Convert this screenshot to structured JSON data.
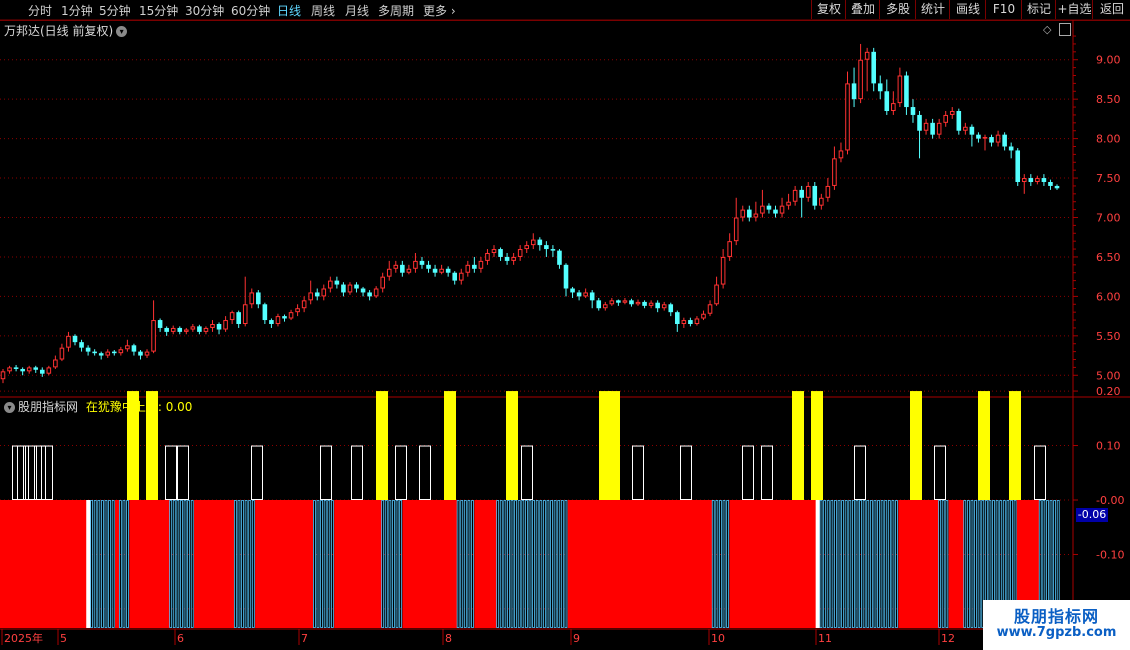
{
  "topbar": {
    "periods": [
      "分时",
      "1分钟",
      "5分钟",
      "15分钟",
      "30分钟",
      "60分钟",
      "日线",
      "周线",
      "月线",
      "多周期",
      "更多"
    ],
    "active_period": "日线",
    "right_buttons": [
      "复权",
      "叠加",
      "多股",
      "统计",
      "画线",
      "F10",
      "标记",
      "+自选",
      "返回"
    ]
  },
  "price_panel": {
    "title": "万邦达(日线 前复权)",
    "y_ticks": [
      "9.00",
      "8.50",
      "8.00",
      "7.50",
      "7.00",
      "6.50",
      "6.00",
      "5.50",
      "5.00"
    ],
    "up_color": "#ff3232",
    "down_color": "#54ffff"
  },
  "indicator_panel": {
    "title": "股朋指标网",
    "label": "在犹豫中上扬: 0.00",
    "y_ticks": [
      "0.20",
      "0.10",
      "-0.00",
      "-0.10",
      "-0.20"
    ],
    "current_value": "-0.06",
    "bar_colors": {
      "red": "#ff0000",
      "yellow": "#ffff00",
      "white": "#ffffff",
      "cyan": "#54c8ff"
    }
  },
  "x_axis": {
    "labels": [
      "2025年",
      "5",
      "6",
      "7",
      "8",
      "9",
      "10",
      "11",
      "12"
    ]
  },
  "chart_data": {
    "type": "candlestick",
    "y_range": [
      4.75,
      9.25
    ],
    "candles": [
      [
        4.95,
        5.05,
        4.9,
        5.08
      ],
      [
        5.05,
        5.1,
        5.02,
        5.12
      ],
      [
        5.1,
        5.08,
        5.05,
        5.13
      ],
      [
        5.08,
        5.05,
        5.0,
        5.1
      ],
      [
        5.05,
        5.1,
        5.02,
        5.12
      ],
      [
        5.1,
        5.07,
        5.03,
        5.12
      ],
      [
        5.07,
        5.02,
        4.98,
        5.1
      ],
      [
        5.02,
        5.1,
        5.0,
        5.12
      ],
      [
        5.1,
        5.2,
        5.08,
        5.25
      ],
      [
        5.2,
        5.35,
        5.18,
        5.4
      ],
      [
        5.35,
        5.5,
        5.3,
        5.55
      ],
      [
        5.5,
        5.42,
        5.38,
        5.52
      ],
      [
        5.42,
        5.35,
        5.3,
        5.45
      ],
      [
        5.35,
        5.3,
        5.25,
        5.38
      ],
      [
        5.3,
        5.28,
        5.25,
        5.33
      ],
      [
        5.28,
        5.25,
        5.2,
        5.3
      ],
      [
        5.25,
        5.3,
        5.22,
        5.33
      ],
      [
        5.3,
        5.28,
        5.25,
        5.32
      ],
      [
        5.28,
        5.33,
        5.25,
        5.36
      ],
      [
        5.33,
        5.38,
        5.3,
        5.45
      ],
      [
        5.38,
        5.3,
        5.25,
        5.4
      ],
      [
        5.3,
        5.25,
        5.2,
        5.32
      ],
      [
        5.25,
        5.3,
        5.22,
        5.33
      ],
      [
        5.3,
        5.7,
        5.28,
        5.95
      ],
      [
        5.7,
        5.6,
        5.55,
        5.72
      ],
      [
        5.6,
        5.55,
        5.5,
        5.62
      ],
      [
        5.55,
        5.6,
        5.52,
        5.63
      ],
      [
        5.6,
        5.55,
        5.52,
        5.62
      ],
      [
        5.55,
        5.58,
        5.52,
        5.6
      ],
      [
        5.58,
        5.62,
        5.55,
        5.65
      ],
      [
        5.62,
        5.55,
        5.52,
        5.64
      ],
      [
        5.55,
        5.6,
        5.52,
        5.62
      ],
      [
        5.6,
        5.65,
        5.55,
        5.7
      ],
      [
        5.65,
        5.58,
        5.52,
        5.67
      ],
      [
        5.58,
        5.7,
        5.55,
        5.75
      ],
      [
        5.7,
        5.8,
        5.65,
        5.82
      ],
      [
        5.8,
        5.65,
        5.6,
        5.82
      ],
      [
        5.65,
        5.9,
        5.62,
        6.25
      ],
      [
        5.9,
        6.05,
        5.85,
        6.1
      ],
      [
        6.05,
        5.9,
        5.85,
        6.08
      ],
      [
        5.9,
        5.7,
        5.65,
        5.92
      ],
      [
        5.7,
        5.65,
        5.6,
        5.72
      ],
      [
        5.65,
        5.75,
        5.62,
        5.78
      ],
      [
        5.75,
        5.72,
        5.68,
        5.77
      ],
      [
        5.72,
        5.8,
        5.7,
        5.83
      ],
      [
        5.8,
        5.85,
        5.75,
        5.9
      ],
      [
        5.85,
        5.95,
        5.8,
        6.0
      ],
      [
        5.95,
        6.05,
        5.9,
        6.2
      ],
      [
        6.05,
        6.0,
        5.95,
        6.1
      ],
      [
        6.0,
        6.1,
        5.95,
        6.15
      ],
      [
        6.1,
        6.2,
        6.05,
        6.25
      ],
      [
        6.2,
        6.15,
        6.1,
        6.25
      ],
      [
        6.15,
        6.05,
        6.0,
        6.18
      ],
      [
        6.05,
        6.15,
        6.02,
        6.18
      ],
      [
        6.15,
        6.1,
        6.05,
        6.18
      ],
      [
        6.1,
        6.05,
        6.0,
        6.12
      ],
      [
        6.05,
        6.0,
        5.95,
        6.08
      ],
      [
        6.0,
        6.1,
        5.98,
        6.13
      ],
      [
        6.1,
        6.25,
        6.05,
        6.3
      ],
      [
        6.25,
        6.35,
        6.2,
        6.45
      ],
      [
        6.35,
        6.4,
        6.3,
        6.45
      ],
      [
        6.4,
        6.3,
        6.25,
        6.45
      ],
      [
        6.3,
        6.35,
        6.28,
        6.4
      ],
      [
        6.35,
        6.45,
        6.3,
        6.55
      ],
      [
        6.45,
        6.4,
        6.35,
        6.5
      ],
      [
        6.4,
        6.35,
        6.3,
        6.45
      ],
      [
        6.35,
        6.3,
        6.25,
        6.4
      ],
      [
        6.3,
        6.35,
        6.28,
        6.4
      ],
      [
        6.35,
        6.3,
        6.25,
        6.38
      ],
      [
        6.3,
        6.2,
        6.15,
        6.32
      ],
      [
        6.2,
        6.3,
        6.15,
        6.35
      ],
      [
        6.3,
        6.4,
        6.25,
        6.45
      ],
      [
        6.4,
        6.35,
        6.3,
        6.5
      ],
      [
        6.35,
        6.45,
        6.3,
        6.5
      ],
      [
        6.45,
        6.55,
        6.4,
        6.6
      ],
      [
        6.55,
        6.6,
        6.5,
        6.65
      ],
      [
        6.6,
        6.5,
        6.45,
        6.62
      ],
      [
        6.5,
        6.45,
        6.4,
        6.55
      ],
      [
        6.45,
        6.5,
        6.4,
        6.55
      ],
      [
        6.5,
        6.6,
        6.45,
        6.65
      ],
      [
        6.6,
        6.65,
        6.55,
        6.7
      ],
      [
        6.65,
        6.72,
        6.6,
        6.8
      ],
      [
        6.72,
        6.65,
        6.58,
        6.75
      ],
      [
        6.65,
        6.6,
        6.5,
        6.7
      ],
      [
        6.6,
        6.58,
        6.5,
        6.65
      ],
      [
        6.58,
        6.4,
        6.35,
        6.6
      ],
      [
        6.4,
        6.1,
        6.0,
        6.42
      ],
      [
        6.1,
        6.05,
        5.98,
        6.12
      ],
      [
        6.05,
        6.0,
        5.95,
        6.08
      ],
      [
        6.0,
        6.05,
        5.98,
        6.1
      ],
      [
        6.05,
        5.95,
        5.85,
        6.08
      ],
      [
        5.95,
        5.85,
        5.82,
        5.98
      ],
      [
        5.85,
        5.9,
        5.82,
        5.93
      ],
      [
        5.9,
        5.95,
        5.88,
        5.98
      ],
      [
        5.95,
        5.92,
        5.88,
        5.96
      ],
      [
        5.92,
        5.95,
        5.9,
        5.98
      ],
      [
        5.95,
        5.9,
        5.87,
        5.97
      ],
      [
        5.9,
        5.93,
        5.88,
        5.96
      ],
      [
        5.93,
        5.88,
        5.85,
        5.95
      ],
      [
        5.88,
        5.92,
        5.85,
        5.95
      ],
      [
        5.92,
        5.85,
        5.8,
        5.95
      ],
      [
        5.85,
        5.9,
        5.82,
        5.93
      ],
      [
        5.9,
        5.8,
        5.75,
        5.92
      ],
      [
        5.8,
        5.65,
        5.55,
        5.82
      ],
      [
        5.65,
        5.7,
        5.6,
        5.73
      ],
      [
        5.7,
        5.65,
        5.62,
        5.73
      ],
      [
        5.65,
        5.72,
        5.63,
        5.75
      ],
      [
        5.72,
        5.78,
        5.7,
        5.82
      ],
      [
        5.78,
        5.9,
        5.75,
        5.95
      ],
      [
        5.9,
        6.15,
        5.88,
        6.25
      ],
      [
        6.15,
        6.5,
        6.1,
        6.6
      ],
      [
        6.5,
        6.7,
        6.45,
        6.8
      ],
      [
        6.7,
        7.0,
        6.65,
        7.25
      ],
      [
        7.0,
        7.1,
        6.95,
        7.15
      ],
      [
        7.1,
        7.0,
        6.95,
        7.15
      ],
      [
        7.0,
        7.05,
        6.95,
        7.2
      ],
      [
        7.05,
        7.15,
        7.0,
        7.35
      ],
      [
        7.15,
        7.1,
        7.05,
        7.18
      ],
      [
        7.1,
        7.05,
        7.0,
        7.15
      ],
      [
        7.05,
        7.15,
        7.0,
        7.25
      ],
      [
        7.15,
        7.2,
        7.1,
        7.3
      ],
      [
        7.2,
        7.35,
        7.15,
        7.4
      ],
      [
        7.35,
        7.25,
        7.0,
        7.4
      ],
      [
        7.25,
        7.4,
        7.2,
        7.45
      ],
      [
        7.4,
        7.15,
        7.1,
        7.45
      ],
      [
        7.15,
        7.25,
        7.1,
        7.3
      ],
      [
        7.25,
        7.4,
        7.2,
        7.5
      ],
      [
        7.4,
        7.75,
        7.35,
        7.9
      ],
      [
        7.75,
        7.85,
        7.7,
        7.95
      ],
      [
        7.85,
        8.7,
        7.8,
        8.85
      ],
      [
        8.7,
        8.5,
        8.4,
        8.9
      ],
      [
        8.5,
        9.0,
        8.45,
        9.2
      ],
      [
        9.0,
        9.1,
        8.6,
        9.15
      ],
      [
        9.1,
        8.7,
        8.6,
        9.15
      ],
      [
        8.7,
        8.6,
        8.5,
        8.8
      ],
      [
        8.6,
        8.35,
        8.3,
        8.75
      ],
      [
        8.35,
        8.45,
        8.3,
        8.6
      ],
      [
        8.45,
        8.8,
        8.4,
        8.9
      ],
      [
        8.8,
        8.4,
        8.3,
        8.85
      ],
      [
        8.4,
        8.3,
        8.2,
        8.5
      ],
      [
        8.3,
        8.1,
        7.75,
        8.35
      ],
      [
        8.1,
        8.2,
        8.05,
        8.25
      ],
      [
        8.2,
        8.05,
        8.0,
        8.25
      ],
      [
        8.05,
        8.2,
        8.0,
        8.25
      ],
      [
        8.2,
        8.3,
        8.15,
        8.35
      ],
      [
        8.3,
        8.35,
        8.25,
        8.4
      ],
      [
        8.35,
        8.1,
        8.05,
        8.38
      ],
      [
        8.1,
        8.15,
        8.05,
        8.2
      ],
      [
        8.15,
        8.05,
        7.9,
        8.18
      ],
      [
        8.05,
        8.0,
        7.95,
        8.08
      ],
      [
        8.0,
        8.02,
        7.85,
        8.05
      ],
      [
        8.02,
        7.95,
        7.9,
        8.05
      ],
      [
        7.95,
        8.05,
        7.9,
        8.1
      ],
      [
        8.05,
        7.9,
        7.85,
        8.08
      ],
      [
        7.9,
        7.85,
        7.75,
        7.95
      ],
      [
        7.85,
        7.45,
        7.4,
        7.88
      ],
      [
        7.45,
        7.5,
        7.3,
        7.55
      ],
      [
        7.5,
        7.45,
        7.4,
        7.55
      ],
      [
        7.45,
        7.5,
        7.42,
        7.53
      ],
      [
        7.5,
        7.45,
        7.4,
        7.55
      ],
      [
        7.45,
        7.4,
        7.35,
        7.48
      ],
      [
        7.4,
        7.37,
        7.35,
        7.42
      ]
    ],
    "indicator_bars": "RRRRRRRRRRRRRRRRRRRRRRRRWBBBBBBBRBBBRRRRRRRRRRRBBBBBBBRRRRRRRRRRRBBBBBBRRRRRRRRRRRRRRRRBBBBBBRRRRRRRRRRRRRBBBBBBRRRRRRRRRRRRRRRBBBBBRRRRRRBBBBBBBBBBBBBBBBBBBBRRRRRRRRRRRRRRRRRRRRRRRRRRRRRRRRRRRRRRRRBBBBBRRRRRRRRRRRRRRRRRRRRRRRRWBBBBBBBBBBBBBBBBBBBBBBRRRRRRRRRRRBBBRRRRBBBBBBBBBBBBBBBRRRRRRBBBBBB",
    "upper_markers": [
      {
        "x": 18,
        "t": "o"
      },
      {
        "x": 23,
        "t": "o"
      },
      {
        "x": 31,
        "t": "o"
      },
      {
        "x": 40,
        "t": "o"
      },
      {
        "x": 47,
        "t": "o"
      },
      {
        "x": 133,
        "t": "y"
      },
      {
        "x": 152,
        "t": "y"
      },
      {
        "x": 171,
        "t": "o"
      },
      {
        "x": 183,
        "t": "o"
      },
      {
        "x": 257,
        "t": "o"
      },
      {
        "x": 326,
        "t": "o"
      },
      {
        "x": 357,
        "t": "o"
      },
      {
        "x": 382,
        "t": "y"
      },
      {
        "x": 401,
        "t": "o"
      },
      {
        "x": 425,
        "t": "o"
      },
      {
        "x": 450,
        "t": "y"
      },
      {
        "x": 512,
        "t": "y"
      },
      {
        "x": 527,
        "t": "o"
      },
      {
        "x": 605,
        "t": "y"
      },
      {
        "x": 614,
        "t": "y"
      },
      {
        "x": 638,
        "t": "o"
      },
      {
        "x": 686,
        "t": "o"
      },
      {
        "x": 748,
        "t": "o"
      },
      {
        "x": 767,
        "t": "o"
      },
      {
        "x": 798,
        "t": "y"
      },
      {
        "x": 817,
        "t": "y"
      },
      {
        "x": 860,
        "t": "o"
      },
      {
        "x": 916,
        "t": "y"
      },
      {
        "x": 940,
        "t": "o"
      },
      {
        "x": 984,
        "t": "y"
      },
      {
        "x": 1015,
        "t": "y"
      },
      {
        "x": 1040,
        "t": "o"
      }
    ]
  }
}
